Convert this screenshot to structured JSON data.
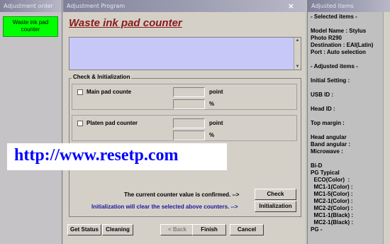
{
  "left_panel": {
    "title": "Adjustment order",
    "selected_item": "Waste ink pad counter"
  },
  "main_panel": {
    "title": "Adjustment Program",
    "close_glyph": "×",
    "header": "Waste ink pad counter",
    "group_label": "Check & Initialization",
    "main_pad": {
      "label": "Main pad counte",
      "unit1": "point",
      "unit2": "%",
      "value_point": "",
      "value_percent": ""
    },
    "platen_pad": {
      "label": "Platen pad counter",
      "unit1": "point",
      "unit2": "%",
      "value_point": "",
      "value_percent": ""
    },
    "confirm_msg": "The current counter value is confirmed. -->",
    "init_msg": "Initialization will clear the selected above counters. -->",
    "check_btn": "Check",
    "init_btn": "Initialization",
    "get_status_btn": "Get Status",
    "cleaning_btn": "Cleaning",
    "back_btn": "< Back",
    "finish_btn": "Finish",
    "cancel_btn": "Cancel"
  },
  "watermark": "http://www.resetp.com",
  "right_panel": {
    "title": "Adjusted items",
    "lines": "- Selected items -\n\nModel Name : Stylus\nPhoto R290\nDestination : EAI(Latin)\nPort : Auto selection\n\n- Adjusted items -\n\nInitial Setting :\n\nUSB ID :\n\nHead ID :\n\nTop margin :\n\nHead angular\nBand angular :\nMicrowave :\n\nBi-D\nPG Typical\n  ECO(Color)  :\n  MC1-1(Color) :\n  MC1-5(Color) :\n  MC2-1(Color) :\n  MC2-2(Color) :\n  MC1-1(Black) :\n  MC2-1(Black) :\nPG -"
  },
  "colors": {
    "accent_green": "#00ff00",
    "header_red": "#8b1a1a",
    "link_blue": "#0000ff",
    "textarea_bg": "#c8c8f8"
  }
}
